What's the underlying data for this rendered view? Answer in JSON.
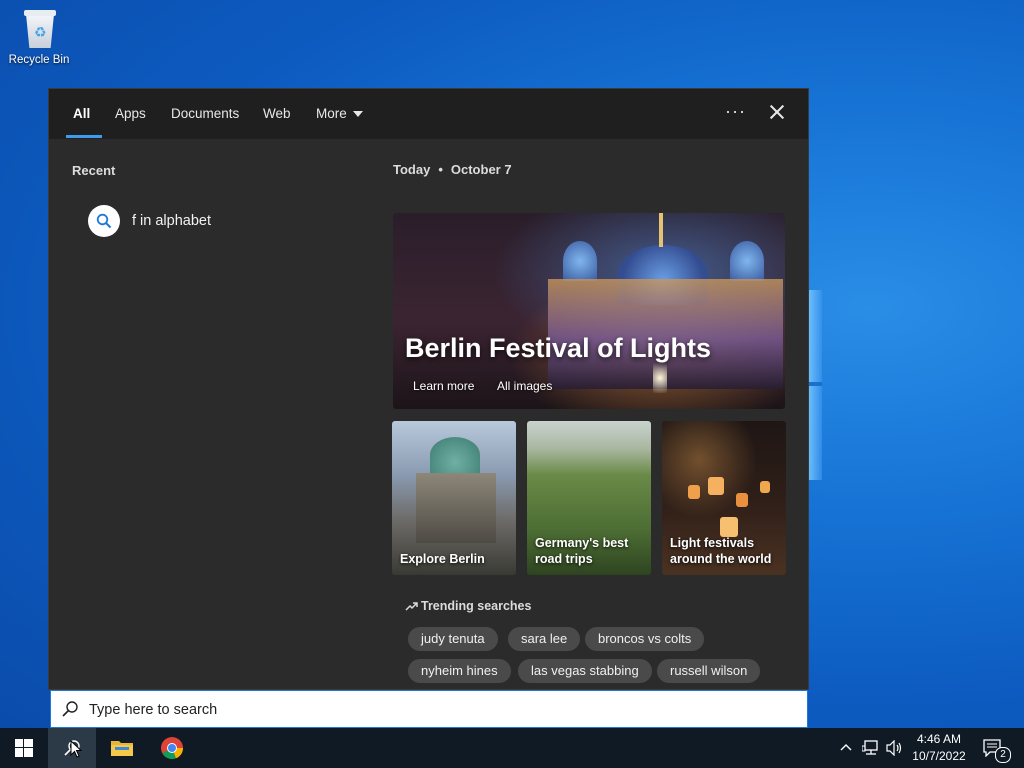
{
  "desktop": {
    "recycle_bin_label": "Recycle Bin"
  },
  "search_panel": {
    "tabs": [
      {
        "label": "All",
        "active": true
      },
      {
        "label": "Apps"
      },
      {
        "label": "Documents"
      },
      {
        "label": "Web"
      },
      {
        "label": "More"
      }
    ],
    "more_options_icon": "ellipsis-icon",
    "close_icon": "close-icon",
    "recent": {
      "title": "Recent",
      "items": [
        {
          "text": "f in alphabet",
          "icon": "search-icon"
        }
      ]
    },
    "today": {
      "label": "Today",
      "separator": "•",
      "date": "October 7"
    },
    "hero": {
      "title": "Berlin Festival of Lights",
      "links": [
        "Learn more",
        "All images"
      ]
    },
    "cards": [
      {
        "label": "Explore Berlin"
      },
      {
        "label": "Germany's best road trips"
      },
      {
        "label": "Light festivals around the world"
      }
    ],
    "trending": {
      "title": "Trending searches",
      "icon": "trending-icon",
      "chips": [
        "judy tenuta",
        "sara lee",
        "broncos vs colts",
        "nyheim hines",
        "las vegas stabbing",
        "russell wilson"
      ]
    }
  },
  "searchbox": {
    "placeholder": "Type here to search"
  },
  "taskbar": {
    "apps": [
      "windows-start",
      "search",
      "file-explorer",
      "chrome"
    ],
    "clock": {
      "time": "4:46 AM",
      "date": "10/7/2022"
    },
    "notification_count": "2"
  },
  "colors": {
    "accent": "#3c9cf0",
    "panel_bg": "#2b2b2b",
    "taskbar_bg": "#101a24"
  }
}
